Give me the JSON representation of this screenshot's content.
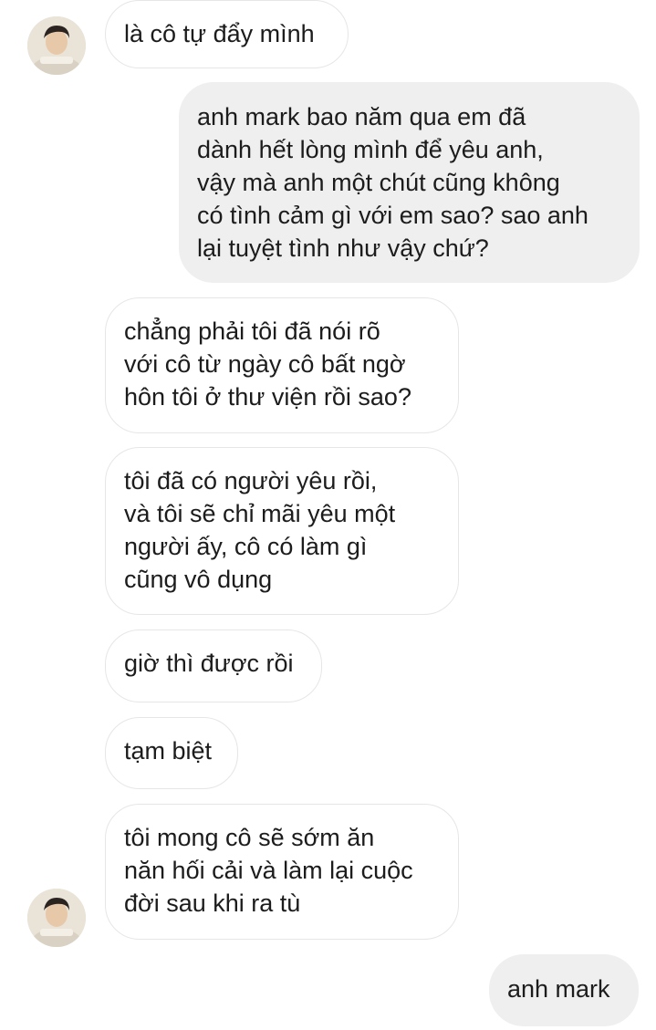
{
  "messages": [
    {
      "sender": "other",
      "text": "là cô tự đẩy mình"
    },
    {
      "sender": "me",
      "text": "anh mark bao năm qua em đã\ndành hết lòng mình để yêu anh,\nvậy mà anh một chút cũng không\ncó tình cảm gì với em sao? sao anh\nlại tuyệt tình như vậy chứ?"
    },
    {
      "sender": "other",
      "text": "chẳng phải tôi đã nói rõ\nvới cô từ ngày cô bất ngờ\nhôn tôi ở thư viện rồi sao?"
    },
    {
      "sender": "other",
      "text": "tôi đã có người yêu rồi,\nvà tôi sẽ chỉ mãi yêu một\nngười ấy, cô có làm gì\ncũng vô dụng"
    },
    {
      "sender": "other",
      "text": "giờ thì được rồi"
    },
    {
      "sender": "other",
      "text": "tạm biệt"
    },
    {
      "sender": "other",
      "text": "tôi mong cô sẽ sớm ăn\nnăn hối cải và làm lại cuộc\nđời sau khi ra tù"
    },
    {
      "sender": "me",
      "text": "anh mark"
    }
  ],
  "colors": {
    "incoming_bubble_bg": "#ffffff",
    "incoming_bubble_border": "#e6e6e6",
    "outgoing_bubble_bg": "#efefef",
    "text": "#1c1c1c"
  },
  "icons": {
    "contact_avatar": "profile-photo"
  }
}
